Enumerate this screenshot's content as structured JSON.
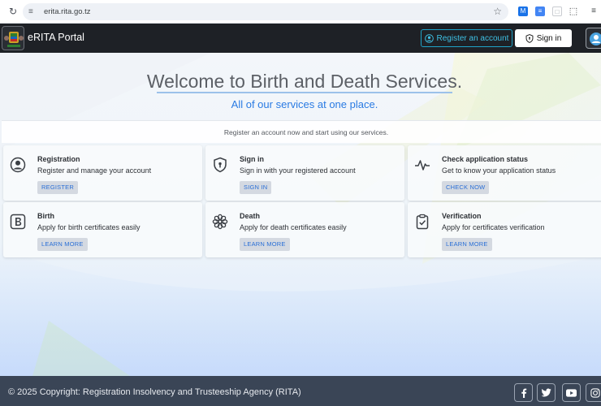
{
  "browser": {
    "url": "erita.rita.go.tz"
  },
  "navbar": {
    "brand": "eRITA Portal",
    "register_label": "Register an account",
    "signin_label": "Sign in"
  },
  "hero": {
    "headline": "Welcome to Birth and Death Services.",
    "subheadline": "All of our services at one place.",
    "prompt": "Register an account now and start using our services."
  },
  "cards": [
    {
      "title": "Registration",
      "description": "Register and manage your account",
      "button": "REGISTER",
      "icon": "user-circle-icon"
    },
    {
      "title": "Sign in",
      "description": "Sign in with your registered account",
      "button": "SIGN IN",
      "icon": "shield-lock-icon"
    },
    {
      "title": "Check application status",
      "description": "Get to know your application status",
      "button": "CHECK NOW",
      "icon": "activity-pulse-icon"
    },
    {
      "title": "Birth",
      "description": "Apply for birth certificates easily",
      "button": "LEARN MORE",
      "icon": "letter-b-icon"
    },
    {
      "title": "Death",
      "description": "Apply for death certificates easily",
      "button": "LEARN MORE",
      "icon": "flower-icon"
    },
    {
      "title": "Verification",
      "description": "Apply for certificates verification",
      "button": "LEARN MORE",
      "icon": "clipboard-check-icon"
    }
  ],
  "footer": {
    "copyright": "© 2025 Copyright: Registration Insolvency and Trusteeship Agency (RITA)",
    "social": [
      "facebook-icon",
      "twitter-icon",
      "youtube-icon",
      "instagram-icon"
    ]
  },
  "colors": {
    "navbar": "#1e2126",
    "accent": "#2a7be3",
    "register_outline": "#1fa2c7",
    "footer": "#3a4556"
  }
}
